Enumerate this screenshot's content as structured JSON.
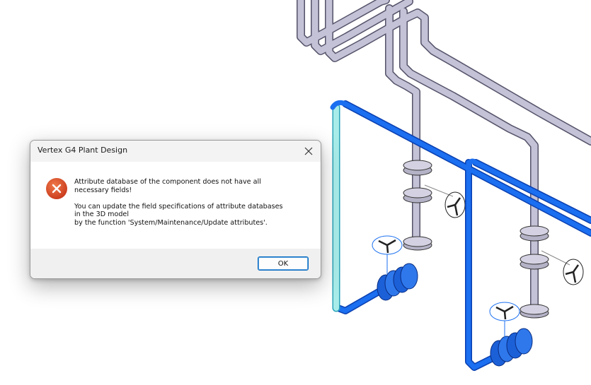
{
  "dialog": {
    "title": "Vertex G4 Plant Design",
    "icon": "error-icon",
    "message_line1": "Attribute database of the component does not have all\nnecessary fields!",
    "message_line2": "You can update the field specifications of attribute databases\nin the 3D model\nby the function 'System/Maintenance/Update attributes'.",
    "ok_label": "OK",
    "close_icon": "close-icon"
  },
  "colors": {
    "error_red": "#e0481f",
    "pipe_gray": "#c4c2d6",
    "pipe_blue": "#1b6ff0",
    "pipe_cyan": "#a8ecea",
    "button_border": "#0067c0"
  }
}
